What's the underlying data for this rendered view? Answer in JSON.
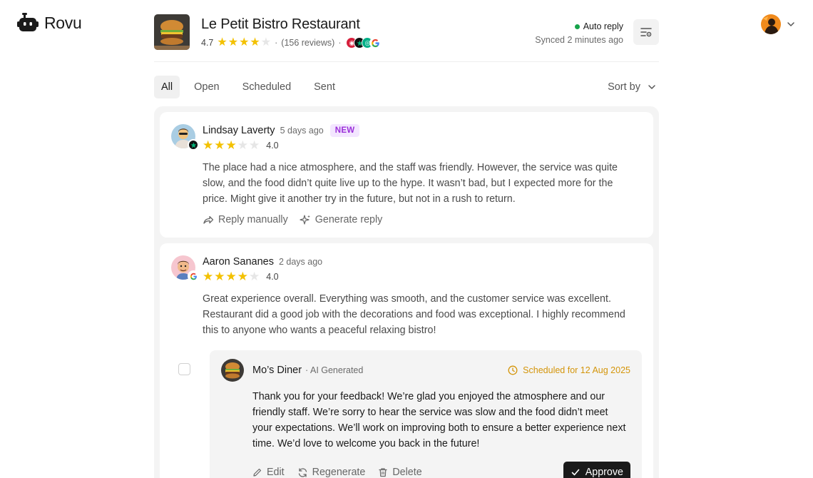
{
  "app": {
    "name": "Rovu"
  },
  "business": {
    "name": "Le Petit Bistro Restaurant",
    "rating": "4.7",
    "rating_value": 4.7,
    "reviews_count": "(156 reviews)",
    "separator": "·",
    "platforms": [
      "tripadvisor",
      "trustpilot",
      "foursquare",
      "google"
    ]
  },
  "status": {
    "auto_reply_label": "Auto reply",
    "synced": "Synced 2 minutes ago"
  },
  "tabs": [
    {
      "label": "All",
      "active": true
    },
    {
      "label": "Open",
      "active": false
    },
    {
      "label": "Scheduled",
      "active": false
    },
    {
      "label": "Sent",
      "active": false
    }
  ],
  "sort": {
    "label": "Sort by"
  },
  "reviews": [
    {
      "author": "Lindsay Laverty",
      "time": "5 days ago",
      "badge": "NEW",
      "stars": 3,
      "rating": "4.0",
      "source": "trustpilot",
      "text": "The place had a nice atmosphere, and the staff was friendly. However, the service was quite slow, and the food didn’t quite live up to the hype. It wasn’t bad, but I expected more for the price. Might give it another try in the future, but not in a rush to return.",
      "actions": {
        "reply_manually": "Reply manually",
        "generate_reply": "Generate reply"
      }
    },
    {
      "author": "Aaron Sananes",
      "time": "2 days ago",
      "stars": 4,
      "rating": "4.0",
      "source": "google",
      "text": "Great experience overall. Everything was smooth, and the customer service was excellent. Restaurant did a good job with the decorations and food was exceptional. I highly recommend this to anyone who wants a peaceful relaxing bistro!",
      "reply": {
        "author": "Mo’s Diner",
        "tag": "· AI Generated",
        "scheduled": "Scheduled for 12 Aug 2025",
        "text": "Thank you for your feedback! We’re glad you enjoyed the atmosphere and our friendly staff. We’re sorry to hear the service was slow and the food didn’t meet your expectations. We’ll work on improving both to ensure a better experience next time. We’d love to welcome you back in the future!",
        "edit": "Edit",
        "regenerate": "Regenerate",
        "delete": "Delete",
        "approve": "Approve"
      }
    }
  ],
  "colors": {
    "star": "#f3c100",
    "new_badge_bg": "#f3e6ff",
    "new_badge_text": "#9b30d9",
    "status_green": "#16a34a",
    "scheduled": "#d4950a",
    "approve_bg": "#1a1a1a"
  }
}
